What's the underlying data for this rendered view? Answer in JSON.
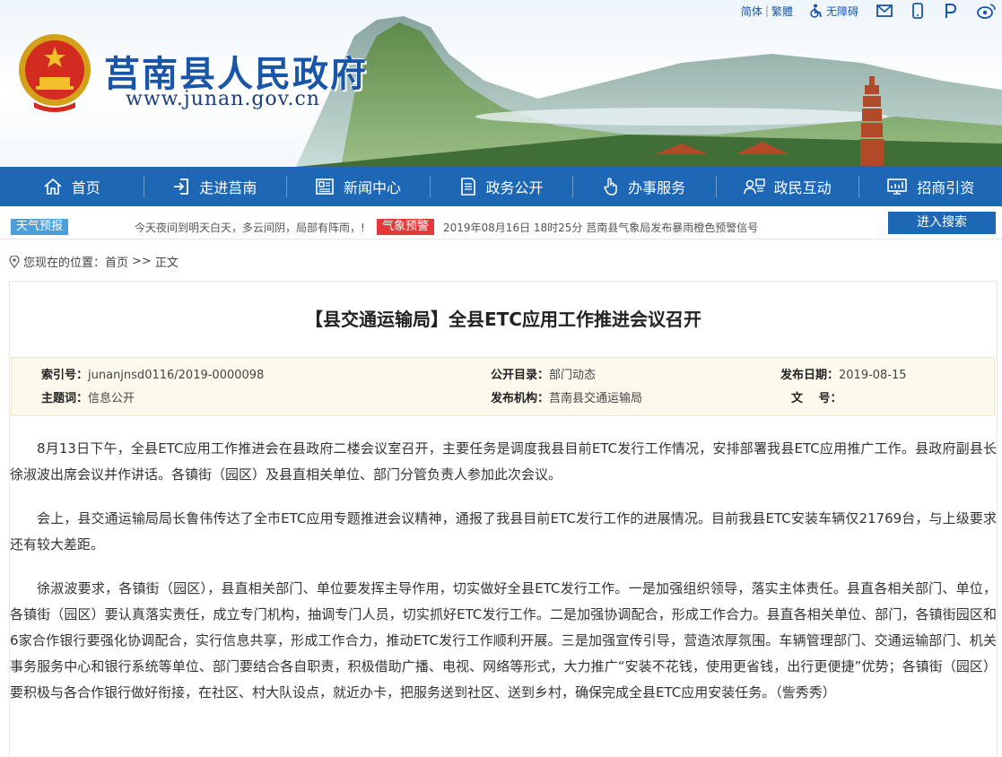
{
  "header": {
    "site_title": "莒南县人民政府",
    "site_url": "www.junan.gov.cn"
  },
  "util_bar": {
    "simplified": "简体",
    "traditional": "繁體",
    "accessibility": "无障碍"
  },
  "nav": {
    "items": [
      {
        "label": "首页",
        "icon": "home-icon"
      },
      {
        "label": "走进莒南",
        "icon": "enter-icon"
      },
      {
        "label": "新闻中心",
        "icon": "news-icon"
      },
      {
        "label": "政务公开",
        "icon": "document-icon"
      },
      {
        "label": "办事服务",
        "icon": "hand-pointer-icon"
      },
      {
        "label": "政民互动",
        "icon": "interaction-icon"
      },
      {
        "label": "招商引资",
        "icon": "investment-icon"
      }
    ]
  },
  "ticker": {
    "weather_tag": "天气预报",
    "weather_text": "今天夜间到明天白天，多云间阴，局部有阵雨，!",
    "warning_tag": "气象预警",
    "warning_text": "2019年08月16日 18时25分  莒南县气象局发布暴雨橙色预警信号",
    "search_button": "进入搜索"
  },
  "breadcrumb": {
    "prefix": "您现在的位置：",
    "home": "首页",
    "separator": ">>",
    "current": "正文"
  },
  "article": {
    "title": "【县交通运输局】全县ETC应用工作推进会议召开",
    "meta": {
      "index_label": "索引号：",
      "index_value": "junanjnsd0116/2019-0000098",
      "catalog_label": "公开目录：",
      "catalog_value": "部门动态",
      "date_label": "发布日期：",
      "date_value": "2019-08-15",
      "subject_label": "主题词：",
      "subject_value": "信息公开",
      "org_label": "发布机构：",
      "org_value": "莒南县交通运输局",
      "docno_label": "文　 号：",
      "docno_value": ""
    },
    "paragraphs": [
      "8月13日下午，全县ETC应用工作推进会在县政府二楼会议室召开，主要任务是调度我县目前ETC发行工作情况，安排部署我县ETC应用推广工作。县政府副县长徐淑波出席会议并作讲话。各镇街（园区）及县直相关单位、部门分管负责人参加此次会议。",
      "会上，县交通运输局局长鲁伟传达了全市ETC应用专题推进会议精神，通报了我县目前ETC发行工作的进展情况。目前我县ETC安装车辆仅21769台，与上级要求还有较大差距。",
      "徐淑波要求，各镇街（园区），县直相关部门、单位要发挥主导作用，切实做好全县ETC发行工作。一是加强组织领导，落实主体责任。县直各相关部门、单位，各镇街（园区）要认真落实责任，成立专门机构，抽调专门人员，切实抓好ETC发行工作。二是加强协调配合，形成工作合力。县直各相关单位、部门，各镇街园区和6家合作银行要强化协调配合，实行信息共享，形成工作合力，推动ETC发行工作顺利开展。三是加强宣传引导，营造浓厚氛围。车辆管理部门、交通运输部门、机关事务服务中心和银行系统等单位、部门要结合各自职责，积极借助广播、电视、网络等形式，大力推广“安装不花钱，使用更省钱，出行更便捷”优势；各镇街（园区）要积极与各合作银行做好衔接，在社区、村大队设点，就近办卡，把服务送到社区、送到乡村，确保完成全县ETC应用安装任务。（訾秀秀）"
    ]
  },
  "colors": {
    "nav_bg": "#1d67b5",
    "title_blue": "#1a56a8",
    "warning_red": "#e23a3a",
    "weather_blue": "#4aa0dc",
    "meta_bg": "#fdf9ec"
  }
}
